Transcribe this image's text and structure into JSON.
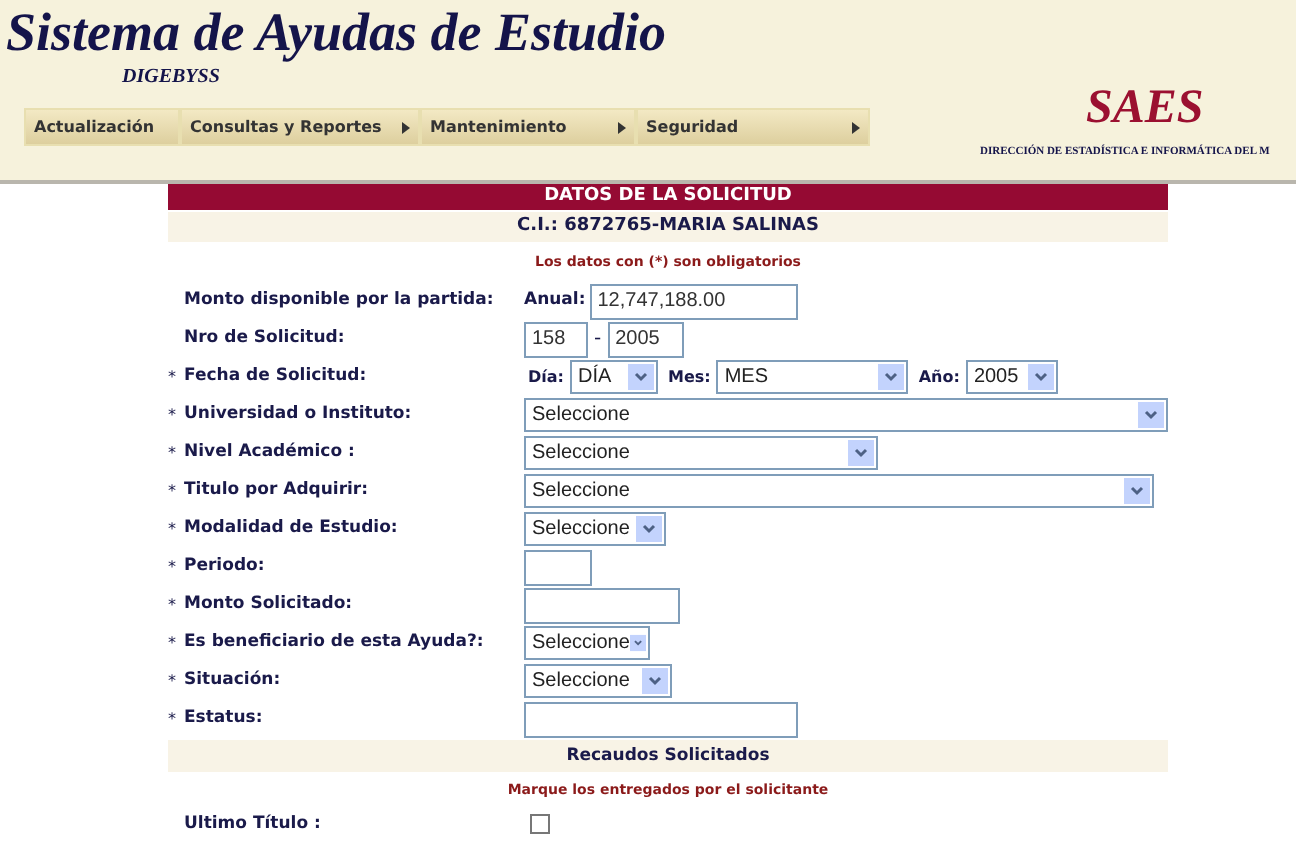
{
  "header": {
    "title": "Sistema de Ayudas de Estudio",
    "subtitle": "DIGEBYSS",
    "logo": "SAES",
    "org": "DIRECCIÓN DE ESTADÍSTICA E INFORMÁTICA DEL M"
  },
  "menu": [
    {
      "label": "Actualización",
      "submenu": false
    },
    {
      "label": "Consultas y Reportes",
      "submenu": true
    },
    {
      "label": "Mantenimiento",
      "submenu": true
    },
    {
      "label": "Seguridad",
      "submenu": true
    }
  ],
  "form": {
    "title": "DATOS DE LA SOLICITUD",
    "person": "C.I.: 6872765-MARIA SALINAS",
    "note": "Los datos con (*) son obligatorios",
    "marker": "*",
    "fields": [
      {
        "kind": "amount",
        "label": "Monto disponible por la partida:",
        "required": false,
        "prefix": "Anual:",
        "value": "12,747,188.00"
      },
      {
        "kind": "pair",
        "label": "Nro de Solicitud:",
        "required": false,
        "value": "158",
        "separator": "-",
        "value2": "2005"
      },
      {
        "kind": "date",
        "label": "Fecha de Solicitud:",
        "required": true,
        "parts": [
          {
            "label": "Día:",
            "value": "DÍA"
          },
          {
            "label": "Mes:",
            "value": "MES"
          },
          {
            "label": "Año:",
            "value": "2005"
          }
        ]
      },
      {
        "kind": "select",
        "label": "Universidad o Instituto:",
        "required": true,
        "value": "Seleccione"
      },
      {
        "kind": "select",
        "label": "Nivel Académico :",
        "required": true,
        "value": "Seleccione"
      },
      {
        "kind": "select",
        "label": "Titulo por Adquirir:",
        "required": true,
        "value": "Seleccione"
      },
      {
        "kind": "select",
        "label": "Modalidad de Estudio:",
        "required": true,
        "value": "Seleccione"
      },
      {
        "kind": "input",
        "label": "Periodo:",
        "required": true
      },
      {
        "kind": "input",
        "label": "Monto Solicitado:",
        "required": true
      },
      {
        "kind": "select",
        "label": "Es beneficiario de esta Ayuda?:",
        "required": true,
        "value": "Seleccione"
      },
      {
        "kind": "select",
        "label": "Situación:",
        "required": true,
        "value": "Seleccione"
      },
      {
        "kind": "input",
        "label": "Estatus:",
        "required": true
      }
    ]
  },
  "documents": {
    "title": "Recaudos Solicitados",
    "note": "Marque los entregados por el solicitante",
    "items": [
      {
        "label": "Ultimo Título :",
        "checked": false
      }
    ]
  }
}
